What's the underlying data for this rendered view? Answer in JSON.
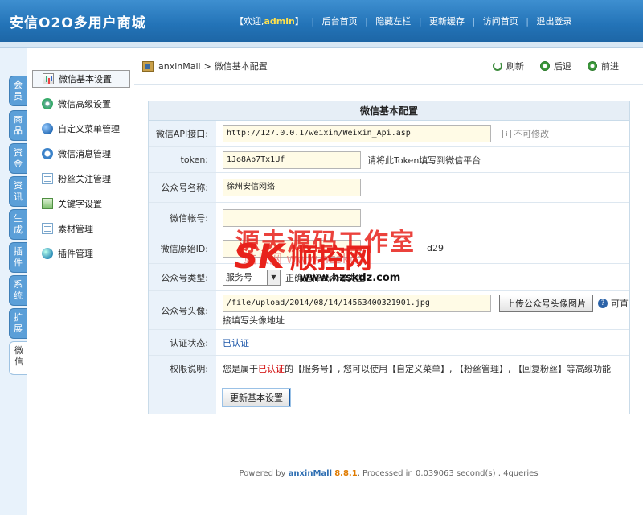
{
  "header": {
    "logo": "安信O2O多用户商城",
    "nav": {
      "welcome_prefix": "【欢迎,",
      "user": "admin",
      "welcome_suffix": "】",
      "items": [
        "后台首页",
        "隐藏左栏",
        "更新缓存",
        "访问首页",
        "退出登录"
      ]
    }
  },
  "vtabs": [
    "会员",
    "商品",
    "资金",
    "资讯",
    "生成",
    "插件",
    "系统",
    "扩展",
    "微信"
  ],
  "sidebar": {
    "items": [
      {
        "label": "微信基本设置",
        "icon": "chart-icon"
      },
      {
        "label": "微信高级设置",
        "icon": "gear-icon"
      },
      {
        "label": "自定义菜单管理",
        "icon": "globe-icon"
      },
      {
        "label": "微信消息管理",
        "icon": "message-icon"
      },
      {
        "label": "粉丝关注管理",
        "icon": "page-icon"
      },
      {
        "label": "关键字设置",
        "icon": "key-icon"
      },
      {
        "label": "素材管理",
        "icon": "page-icon"
      },
      {
        "label": "插件管理",
        "icon": "globe-icon"
      }
    ]
  },
  "breadcrumb": {
    "root": "anxinMall",
    "sep": ">",
    "current": "微信基本配置"
  },
  "actions": {
    "refresh": "刷新",
    "back": "后退",
    "forward": "前进"
  },
  "form": {
    "title": "微信基本配置",
    "api": {
      "label": "微信API接口:",
      "value": "http://127.0.0.1/weixin/Weixin_Api.asp",
      "note": "不可修改"
    },
    "token": {
      "label": "token:",
      "value": "1Jo8Ap7Tx1Uf",
      "note": "请将此Token填写到微信平台"
    },
    "name": {
      "label": "公众号名称:",
      "value": "徐州安信网络"
    },
    "account": {
      "label": "微信帐号:",
      "value": ""
    },
    "original_id": {
      "label": "微信原始ID:",
      "value": "",
      "note": "d29"
    },
    "type": {
      "label": "公众号类型:",
      "selected": "服务号",
      "note": "正确选择公众号类型"
    },
    "avatar": {
      "label": "公众号头像:",
      "value": "/file/upload/2014/08/14/14563400321901.jpg",
      "upload_button": "上传公众号头像图片",
      "note_a": "可直",
      "note_b": "接填写头像地址"
    },
    "auth": {
      "label": "认证状态:",
      "value": "已认证"
    },
    "perm": {
      "label": "权限说明:",
      "text_a": "您是属于",
      "text_red": "已认证",
      "text_b": "的【服务号】, 您可以使用【自定义菜单】, 【粉丝管理】, 【回复粉丝】等高级功能"
    },
    "submit": "更新基本设置"
  },
  "footer": {
    "prefix": "Powered by ",
    "brand": "anxinMall",
    "version": "8.8.1",
    "suffix": ", Processed in 0.039063 second(s) , 4queries"
  },
  "watermark": {
    "line1": "源夫源码工作室",
    "line2": "站长网 www.hzskdz",
    "sk": "SK",
    "name": "顺控网",
    "url": "www.hzskdz.com"
  }
}
